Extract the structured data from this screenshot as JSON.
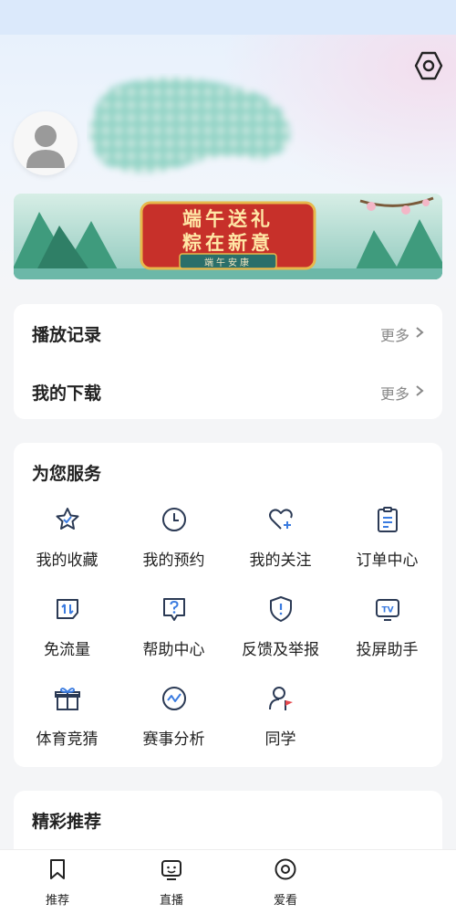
{
  "colors": {
    "icon_stroke": "#2b3a55",
    "accent_red": "#e5484d",
    "accent_blue": "#3a7be0",
    "text_gray": "#888888"
  },
  "header": {
    "settings_icon": "settings-hexagon-icon",
    "avatar_icon": "default-avatar-icon"
  },
  "banner": {
    "title_line1": "端午送礼",
    "title_line2": "粽在新意",
    "subtitle": "端午安康"
  },
  "history": {
    "play_record_label": "播放记录",
    "play_record_more": "更多",
    "download_label": "我的下载",
    "download_more": "更多"
  },
  "services": {
    "title": "为您服务",
    "items": [
      {
        "label": "我的收藏",
        "icon": "star-icon"
      },
      {
        "label": "我的预约",
        "icon": "clock-icon"
      },
      {
        "label": "我的关注",
        "icon": "heart-plus-icon"
      },
      {
        "label": "订单中心",
        "icon": "clipboard-icon"
      },
      {
        "label": "免流量",
        "icon": "data-free-icon"
      },
      {
        "label": "帮助中心",
        "icon": "help-icon"
      },
      {
        "label": "反馈及举报",
        "icon": "shield-alert-icon"
      },
      {
        "label": "投屏助手",
        "icon": "tv-cast-icon"
      },
      {
        "label": "体育竞猜",
        "icon": "gift-icon"
      },
      {
        "label": "赛事分析",
        "icon": "chart-circle-icon"
      },
      {
        "label": "同学",
        "icon": "classmate-icon"
      }
    ]
  },
  "recommend": {
    "title": "精彩推荐"
  },
  "tabbar": {
    "tabs": [
      {
        "label": "推荐",
        "icon": "bookmark-icon"
      },
      {
        "label": "直播",
        "icon": "tv-face-icon"
      },
      {
        "label": "爱看",
        "icon": "target-icon"
      }
    ]
  }
}
